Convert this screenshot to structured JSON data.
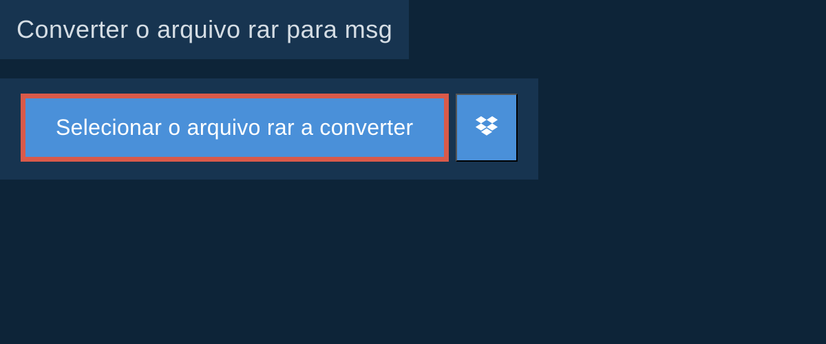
{
  "header": {
    "title": "Converter o arquivo rar para msg"
  },
  "main": {
    "select_button_label": "Selecionar o arquivo rar a converter"
  },
  "colors": {
    "background": "#0d2438",
    "panel": "#173450",
    "button": "#4a90d9",
    "highlight_border": "#d95a4a",
    "text_light": "#d5dde4",
    "text_white": "#ffffff"
  }
}
